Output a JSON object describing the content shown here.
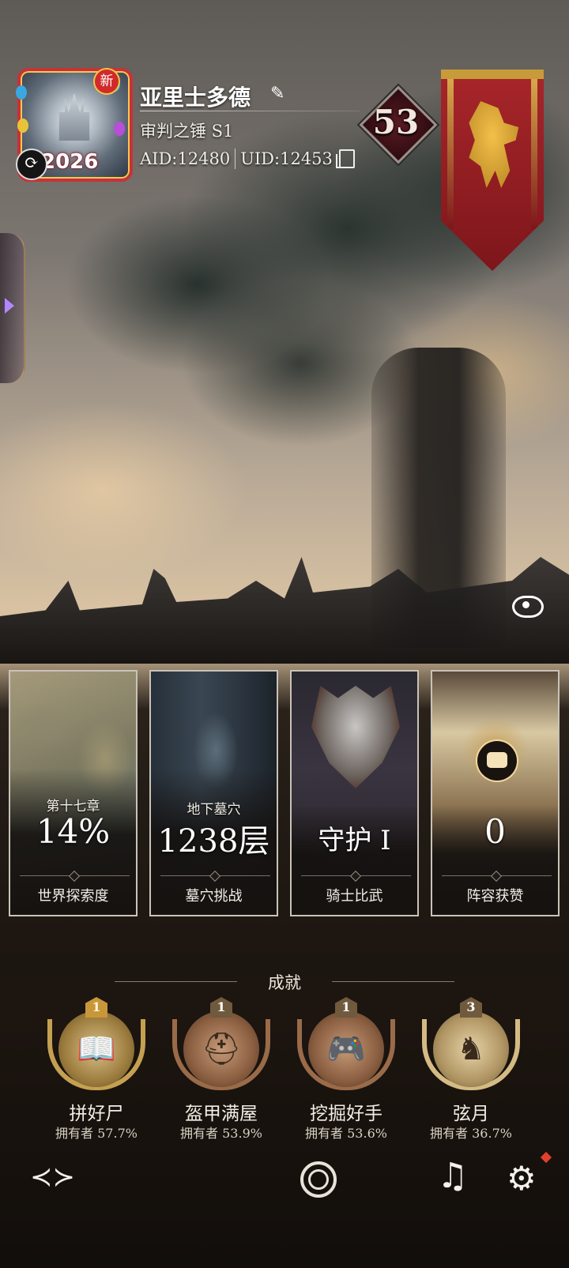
{
  "profile": {
    "avatar_year": "2026",
    "avatar_badge": "新",
    "name": "亚里士多德",
    "guild": "审判之锤 S1",
    "aid": "AID:12480",
    "uid": "UID:12453",
    "level": "53"
  },
  "stats": [
    {
      "sub": "第十七章",
      "value": "14%",
      "label": "世界探索度"
    },
    {
      "sub": "地下墓穴",
      "value": "1238层",
      "label": "墓穴挑战"
    },
    {
      "sub": "",
      "value": "守护 I",
      "label": "骑士比武"
    },
    {
      "sub": "",
      "value": "0",
      "label": "阵容获赞"
    }
  ],
  "achievements": {
    "title": "成就",
    "items": [
      {
        "count": "1",
        "name": "拼好尸",
        "owned": "拥有者 57.7%"
      },
      {
        "count": "1",
        "name": "盔甲满屋",
        "owned": "拥有者 53.9%"
      },
      {
        "count": "1",
        "name": "挖掘好手",
        "owned": "拥有者 53.6%"
      },
      {
        "count": "3",
        "name": "弦月",
        "owned": "拥有者 36.7%"
      }
    ]
  },
  "colors": {
    "banner": "#a8262a",
    "accent_gold": "#c7973a",
    "notification": "#e0412b"
  },
  "icons": [
    "swap-icon",
    "edit-icon",
    "copy-icon",
    "eye-icon",
    "logo-icon",
    "globe-icon",
    "music-icon",
    "gear-icon"
  ]
}
